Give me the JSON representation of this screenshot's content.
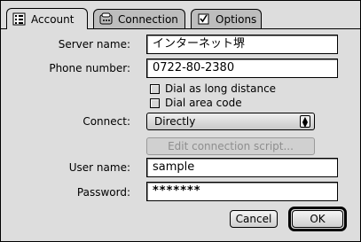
{
  "tabs": [
    {
      "label": "Account",
      "icon": "account-icon",
      "active": true
    },
    {
      "label": "Connection",
      "icon": "connection-icon",
      "active": false
    },
    {
      "label": "Options",
      "icon": "checkbox-icon",
      "active": false
    }
  ],
  "form": {
    "server_name": {
      "label": "Server name:",
      "value": "インターネット堺"
    },
    "phone_number": {
      "label": "Phone number:",
      "value": "0722-80-2380"
    },
    "dial_long_distance": {
      "label": "Dial as long distance",
      "checked": false
    },
    "dial_area_code": {
      "label": "Dial area code",
      "checked": false
    },
    "connect": {
      "label": "Connect:",
      "value": "Directly"
    },
    "edit_script": {
      "label": "Edit connection script..."
    },
    "user_name": {
      "label": "User name:",
      "value": "sample"
    },
    "password": {
      "label": "Password:",
      "value": "*******"
    }
  },
  "buttons": {
    "cancel": "Cancel",
    "ok": "OK"
  }
}
